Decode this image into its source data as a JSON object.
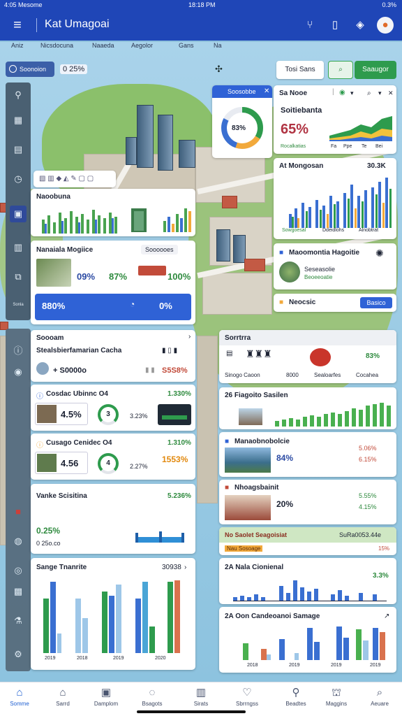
{
  "status": {
    "time_left": "4:05 Mesome",
    "time_center": "18:18 PM",
    "right": "0.3%"
  },
  "appbar": {
    "title": "Kat Umagoai",
    "menu_icon": "hamburger-icon",
    "icons": [
      "filter-icon",
      "book-icon",
      "shield-icon",
      "profile-icon"
    ]
  },
  "subnav": [
    "Aniz",
    "Nicsdocuna",
    "Naaeda",
    "Aegolor",
    "Gans",
    "Na"
  ],
  "toolbar": {
    "chip": "Soonoion",
    "value": "0 25%",
    "btn_text": "Tosi Sans",
    "btn_green": "Saaugor"
  },
  "rail_icons": [
    "location-icon",
    "table-icon",
    "grid-icon",
    "clock-icon",
    "active-tab-icon",
    "book-icon",
    "info-icon",
    "bell-icon"
  ],
  "rail_label": "Sonla",
  "rail2_icons": [
    "info-icon",
    "badge-icon",
    "camera-icon",
    "red-flag-icon",
    "avatar-icon",
    "target-icon",
    "photo-icon",
    "flask-icon",
    "settings-icon"
  ],
  "donut": {
    "title": "Soosobbe",
    "value": "83%"
  },
  "card_tr": {
    "title": "Sa Nooe",
    "header": "Soitiebanta",
    "value": "65%",
    "legend": [
      "Rocalkatias",
      "Fa",
      "Ppe",
      "Te",
      "Bei"
    ]
  },
  "card_nego": {
    "title": "At Mongosan",
    "value": "30.3K",
    "legend": [
      "Sowgoesal",
      "Ddeidlohs",
      "Alnobtrat"
    ]
  },
  "card_nao": {
    "title": "Naoobuna"
  },
  "card_mono": {
    "title": "Nanaiala Mogiice",
    "badge": "Soooooes",
    "v1": "09%",
    "v2": "87%",
    "v3": "100%",
    "blue_left": "880%",
    "blue_right": "0%"
  },
  "card_hagnie": {
    "title": "Maoomontia Hagoitie",
    "sub": "Seseasolie",
    "sub2": "Beoeeoatie"
  },
  "card_neocsic": {
    "title": "Neocsic",
    "button": "Basico"
  },
  "card_sosm": {
    "title": "Soooam",
    "line": "Stealsbierfamarian Cacha",
    "v1": "+ S0000o",
    "v2": "S5S8%"
  },
  "card_cu1": {
    "title": "Cosdac Ubinnc O4",
    "pct": "1.330%",
    "v": "4.5%",
    "ring": "3",
    "v2": "3.23%"
  },
  "card_cu2": {
    "title": "Cusago Cenidec O4",
    "pct": "1.310%",
    "v": "4.56",
    "ring": "4",
    "v2": "2.27%",
    "v3": "1553%"
  },
  "card_vake": {
    "title": "Vanke Scisitina",
    "pct": "5.236%",
    "v1": "0.25%",
    "v2": "0 25o.co"
  },
  "card_sange": {
    "title": "Sange Tnanrite",
    "value": "30938",
    "years": [
      "2019",
      "2018",
      "2019",
      "2020"
    ]
  },
  "card_sm": {
    "title": "Sorrtrra",
    "pct": "83%",
    "legend": [
      "Sinogo Caoon",
      "8000",
      "Sealoarfes",
      "Cocahea"
    ]
  },
  "card_sf": {
    "title": "26 Fiagoito Sasilen"
  },
  "card_mb": {
    "title": "Manaobnobolcie",
    "v1": "84%",
    "v2": "5.06%",
    "v3": "6.15%"
  },
  "card_hb": {
    "title": "Nhoagsbainit",
    "v1": "20%",
    "v2": "5.55%",
    "v3": "4.15%"
  },
  "card_green": {
    "title": "No Saolet Seagoisiat",
    "left": "Nau Sosoage",
    "right": "SuRa0053.44e",
    "pct": "15%"
  },
  "card_nc": {
    "title": "2A Nala Cionienal",
    "pct": "3.3%"
  },
  "card_oc": {
    "title": "2A Oon Candeoanoi Samage",
    "years": [
      "2018",
      "2019",
      "2019",
      "2019"
    ]
  },
  "tabs": [
    {
      "label": "Somme",
      "icon": "home-icon"
    },
    {
      "label": "Sarrd",
      "icon": "house-icon"
    },
    {
      "label": "Damplom",
      "icon": "document-icon"
    },
    {
      "label": "Bsagots",
      "icon": "chat-icon"
    },
    {
      "label": "Sirats",
      "icon": "chart-icon"
    },
    {
      "label": "Sbrrngss",
      "icon": "map-icon"
    },
    {
      "label": "Beadtes",
      "icon": "pin-icon"
    },
    {
      "label": "Maggins",
      "icon": "cart-icon"
    },
    {
      "label": "Aeuare",
      "icon": "search-icon"
    }
  ]
}
